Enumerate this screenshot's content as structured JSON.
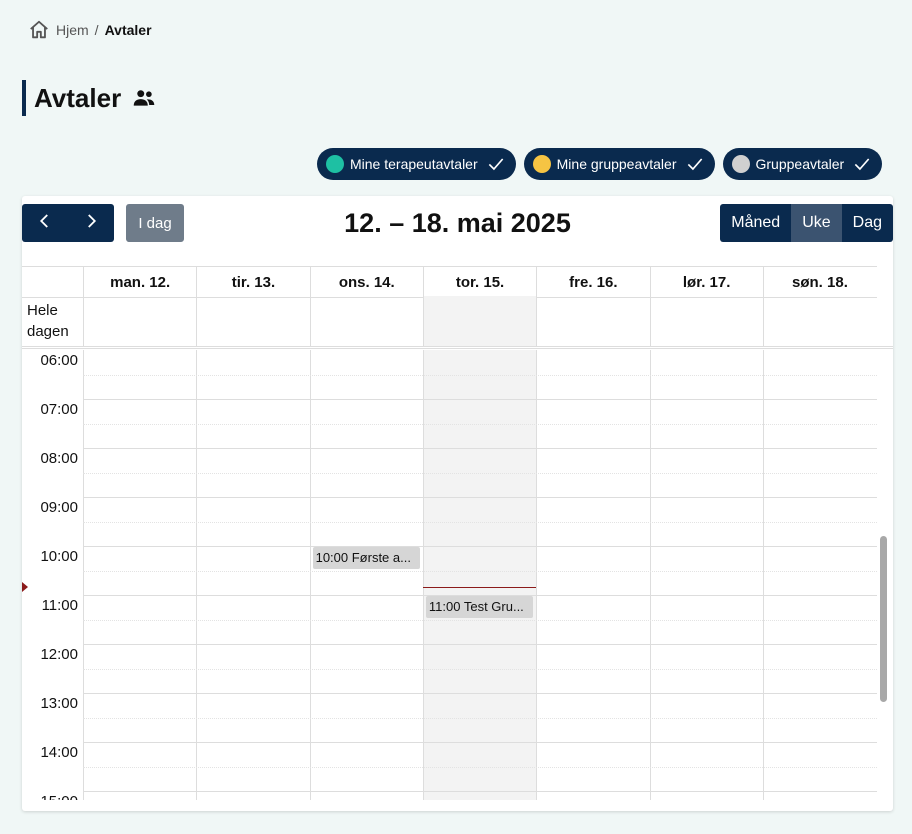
{
  "breadcrumb": {
    "home": "Hjem",
    "separator": "/",
    "current": "Avtaler"
  },
  "page": {
    "title": "Avtaler",
    "title_icon": "people-icon"
  },
  "filters": [
    {
      "label": "Mine terapeutavtaler",
      "dot_color": "#1ec0a3",
      "checked": true
    },
    {
      "label": "Mine gruppeavtaler",
      "dot_color": "#f6c443",
      "checked": true
    },
    {
      "label": "Gruppeavtaler",
      "dot_color": "#d0d0d0",
      "checked": true
    }
  ],
  "toolbar": {
    "prev_icon": "chevron-left-icon",
    "next_icon": "chevron-right-icon",
    "today_label": "I dag",
    "range_title": "12. – 18. mai 2025",
    "views": [
      {
        "label": "Måned",
        "active": false
      },
      {
        "label": "Uke",
        "active": true
      },
      {
        "label": "Dag",
        "active": false
      }
    ]
  },
  "calendar": {
    "days": [
      "man. 12.",
      "tir. 13.",
      "ons. 14.",
      "tor. 15.",
      "fre. 16.",
      "lør. 17.",
      "søn. 18."
    ],
    "today_index": 3,
    "allday_label_line1": "Hele",
    "allday_label_line2": "dagen",
    "hours": [
      "06:00",
      "07:00",
      "08:00",
      "09:00",
      "10:00",
      "11:00",
      "12:00",
      "13:00",
      "14:00",
      "15:00"
    ],
    "events": [
      {
        "day_index": 2,
        "start": "10:00",
        "label": "10:00 Første a..."
      },
      {
        "day_index": 3,
        "start": "11:00",
        "label": "11:00 Test Gru..."
      }
    ],
    "now_time": "10:50",
    "event_color": "#d6d6d6",
    "now_color": "#8b1a1a"
  }
}
